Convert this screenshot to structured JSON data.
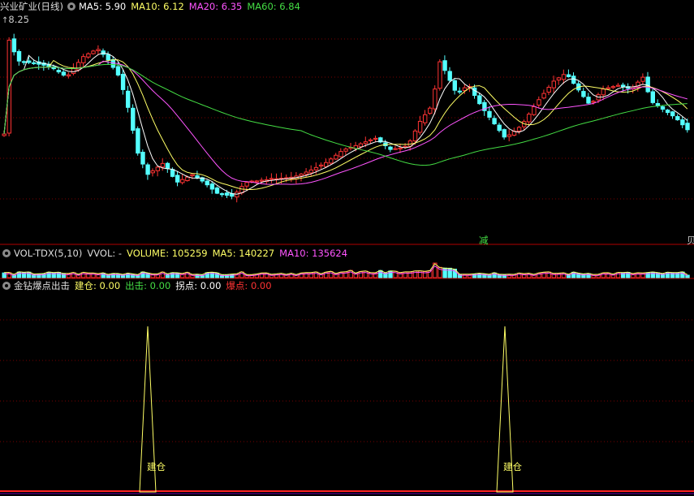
{
  "main": {
    "title": "兴业矿业(日线)",
    "ma5": "MA5: 5.90",
    "ma10": "MA10: 6.12",
    "ma20": "MA20: 6.35",
    "ma60": "MA60: 6.84",
    "high_price": "8.25",
    "icon": "gear-icon",
    "reduce_label": "减",
    "right_label": "贝"
  },
  "volume": {
    "title": "VOL-TDX(5,10)",
    "vvol": "VVOL: -",
    "vol": "VOLUME: 105259",
    "ma5": "MA5: 140227",
    "ma10": "MA10: 135624",
    "icon": "gear-icon"
  },
  "indicator": {
    "title": "金钻爆点出击",
    "build": "建仓: 0.00",
    "exit": "出击: 0.00",
    "turn": "拐点: 0.00",
    "burst": "爆点: 0.00",
    "icon": "gear-icon",
    "signal_label": "建仓",
    "signal_label_2": "建仓"
  },
  "colors": {
    "up": "#ff3333",
    "down": "#54ffff",
    "ma5": "#ffffff",
    "ma10": "#ffff66",
    "ma20": "#ff55ff",
    "ma60": "#44dd44",
    "grid": "#7a0000"
  }
}
